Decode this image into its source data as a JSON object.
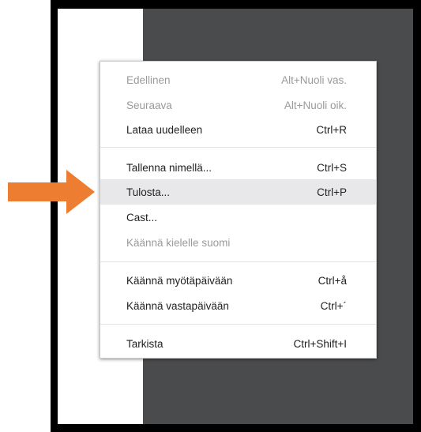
{
  "menu": {
    "items": [
      {
        "label": "Edellinen",
        "shortcut": "Alt+Nuoli vas.",
        "disabled": true
      },
      {
        "label": "Seuraava",
        "shortcut": "Alt+Nuoli oik.",
        "disabled": true
      },
      {
        "label": "Lataa uudelleen",
        "shortcut": "Ctrl+R",
        "disabled": false
      },
      {
        "label": "Tallenna nimellä...",
        "shortcut": "Ctrl+S",
        "disabled": false
      },
      {
        "label": "Tulosta...",
        "shortcut": "Ctrl+P",
        "disabled": false,
        "highlighted": true
      },
      {
        "label": "Cast...",
        "shortcut": "",
        "disabled": false
      },
      {
        "label": "Käännä kielelle suomi",
        "shortcut": "",
        "disabled": true
      },
      {
        "label": "Käännä myötäpäivään",
        "shortcut": "Ctrl+å",
        "disabled": false
      },
      {
        "label": "Käännä vastapäivään",
        "shortcut": "Ctrl+´",
        "disabled": false
      },
      {
        "label": "Tarkista",
        "shortcut": "Ctrl+Shift+I",
        "disabled": false
      }
    ]
  },
  "colors": {
    "arrow": "#ed7d31",
    "background_dark": "#4a4b4d",
    "highlight": "#e8e8ea"
  },
  "icons": {
    "pointer": "right-arrow-icon"
  }
}
